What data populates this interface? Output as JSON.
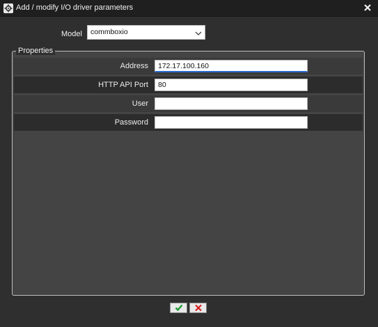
{
  "window": {
    "title": "Add / modify I/O driver parameters"
  },
  "icons": {
    "app": "gear-icon",
    "close": "close-icon",
    "dropdown": "chevron-down-icon",
    "ok": "check-icon",
    "cancel": "x-icon"
  },
  "model": {
    "label": "Model",
    "value": "commboxio"
  },
  "properties": {
    "legend": "Properties",
    "fields": [
      {
        "label": "Address",
        "value": "172.17.100.160"
      },
      {
        "label": "HTTP API Port",
        "value": "80"
      },
      {
        "label": "User",
        "value": ""
      },
      {
        "label": "Password",
        "value": ""
      }
    ]
  },
  "colors": {
    "ok": "#1f9a36",
    "cancel": "#d62020",
    "focus": "#2a6bd1"
  }
}
